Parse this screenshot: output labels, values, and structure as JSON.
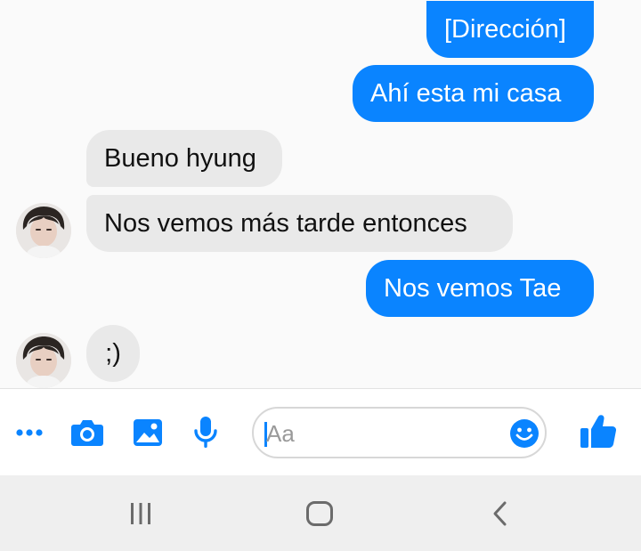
{
  "messages": [
    {
      "text": "[Dirección]",
      "direction": "outgoing"
    },
    {
      "text": "Ahí esta mi casa",
      "direction": "outgoing"
    },
    {
      "text": "Bueno hyung",
      "direction": "incoming"
    },
    {
      "text": "Nos vemos más tarde entonces",
      "direction": "incoming"
    },
    {
      "text": "Nos vemos Tae",
      "direction": "outgoing"
    },
    {
      "text": ";)",
      "direction": "incoming"
    }
  ],
  "composer": {
    "placeholder": "Aa",
    "icons": [
      "more-icon",
      "camera-icon",
      "image-icon",
      "microphone-icon",
      "emoji-icon",
      "thumbs-up-icon"
    ]
  },
  "navbar": {
    "icons": [
      "recent-apps-icon",
      "home-icon",
      "back-icon"
    ]
  },
  "colors": {
    "accent": "#0a84ff",
    "incoming_bubble": "#e9e9e9",
    "background": "#fafafa"
  }
}
